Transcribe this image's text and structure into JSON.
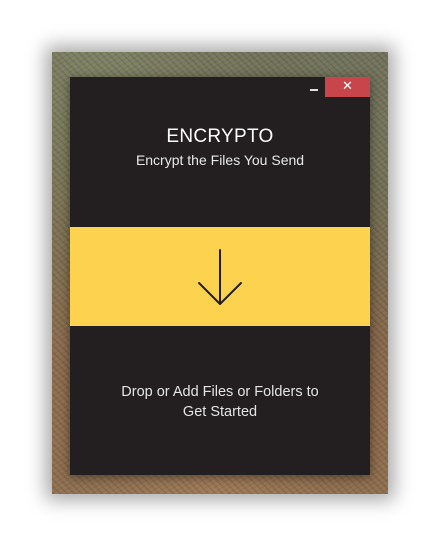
{
  "window": {
    "minimize_label": "_",
    "close_label": "✕",
    "close_color": "#c7454b"
  },
  "header": {
    "title": "ENCRYPTO",
    "subtitle": "Encrypt the Files You Send"
  },
  "drop_zone": {
    "icon": "down-arrow-icon",
    "color": "#fdd24f",
    "instruction_line1": "Drop or Add Files or Folders to",
    "instruction_line2": "Get Started"
  },
  "theme": {
    "window_background": "#231f20",
    "accent": "#fdd24f"
  }
}
